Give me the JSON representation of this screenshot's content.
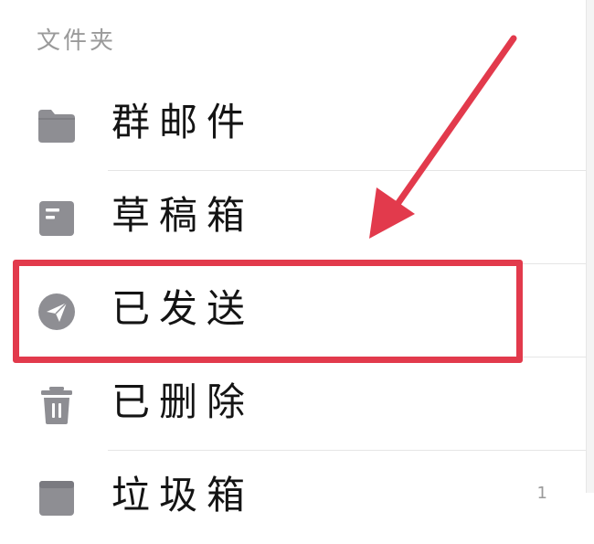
{
  "section": {
    "title": "文件夹"
  },
  "folders": [
    {
      "label": "群邮件",
      "icon": "folder-icon",
      "count": ""
    },
    {
      "label": "草稿箱",
      "icon": "draft-icon",
      "count": ""
    },
    {
      "label": "已发送",
      "icon": "sent-icon",
      "count": ""
    },
    {
      "label": "已删除",
      "icon": "trash-icon",
      "count": ""
    },
    {
      "label": "垃圾箱",
      "icon": "spam-icon",
      "count": "1"
    }
  ],
  "colors": {
    "icon_gray": "#8e8e93",
    "annotation_red": "#e23a4c",
    "text": "#141414",
    "secondary_text": "#9a9a9a"
  }
}
